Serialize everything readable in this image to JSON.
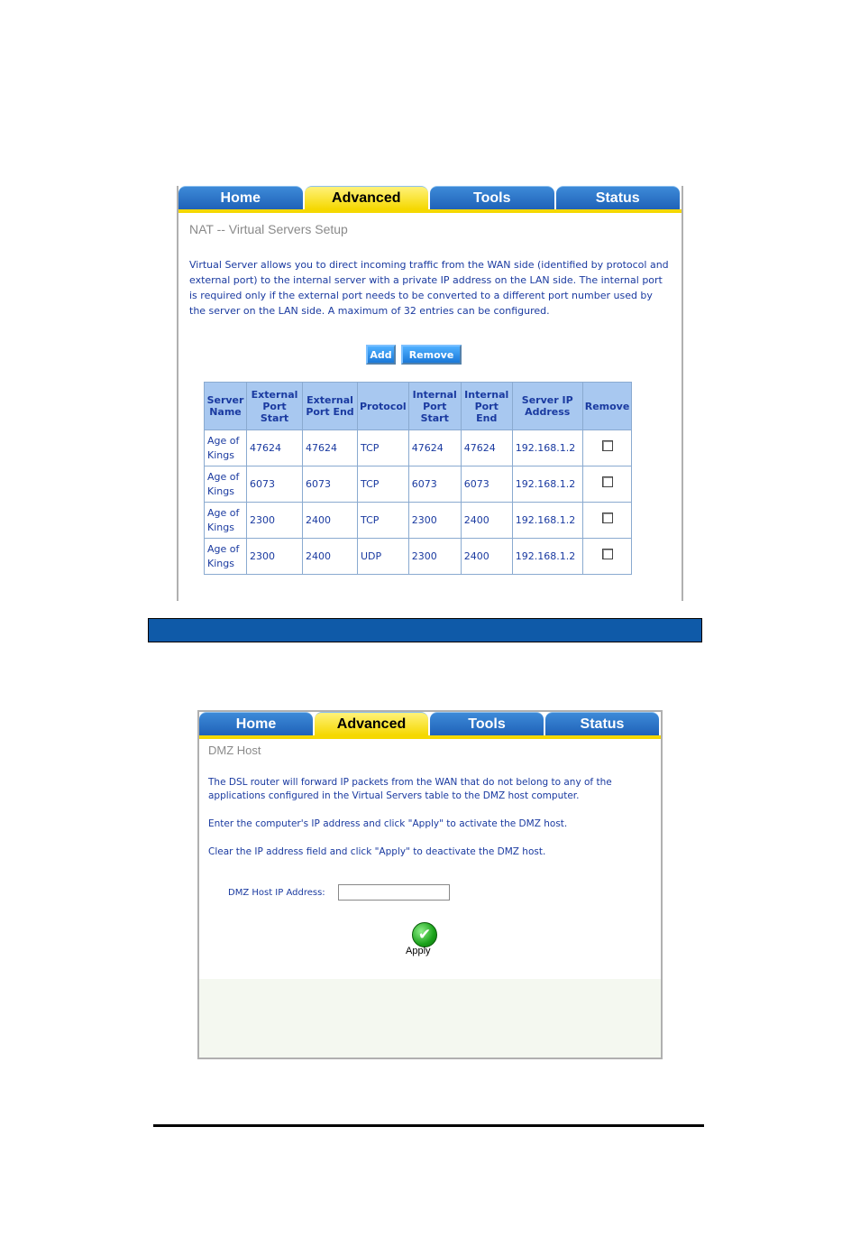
{
  "nat_screen": {
    "tabs": [
      "Home",
      "Advanced",
      "Tools",
      "Status"
    ],
    "active_tab": "Advanced",
    "title": "NAT -- Virtual Servers Setup",
    "description": "Virtual Server allows you to direct incoming traffic from the WAN side (identified by protocol and external port) to the internal server with a private IP address on the LAN side. The internal port is required only if the external port needs to be converted to a different port number used by the server on the LAN side. A maximum of 32 entries can be configured.",
    "add_label": "Add",
    "remove_label": "Remove",
    "headers": [
      "Server Name",
      "External Port Start",
      "External Port End",
      "Protocol",
      "Internal Port Start",
      "Internal Port End",
      "Server IP Address",
      "Remove"
    ],
    "rows": [
      [
        "Age of Kings",
        "47624",
        "47624",
        "TCP",
        "47624",
        "47624",
        "192.168.1.2"
      ],
      [
        "Age of Kings",
        "6073",
        "6073",
        "TCP",
        "6073",
        "6073",
        "192.168.1.2"
      ],
      [
        "Age of Kings",
        "2300",
        "2400",
        "TCP",
        "2300",
        "2400",
        "192.168.1.2"
      ],
      [
        "Age of Kings",
        "2300",
        "2400",
        "UDP",
        "2300",
        "2400",
        "192.168.1.2"
      ]
    ]
  },
  "dmz_screen": {
    "tabs": [
      "Home",
      "Advanced",
      "Tools",
      "Status"
    ],
    "active_tab": "Advanced",
    "title": "DMZ Host",
    "para1": "The DSL router will forward IP packets from the WAN that do not belong to any of the applications configured in the Virtual Servers table to the DMZ host computer.",
    "para2": "Enter the computer's IP address and click \"Apply\" to activate the DMZ host.",
    "para3": "Clear the IP address field and click \"Apply\" to deactivate the DMZ host.",
    "field_label": "DMZ Host IP Address:",
    "field_value": "",
    "apply_label": "Apply"
  },
  "colors": {
    "tab_blue": "#1f62b8",
    "tab_active": "#f5d800",
    "section_bar": "#0f5aa8"
  }
}
